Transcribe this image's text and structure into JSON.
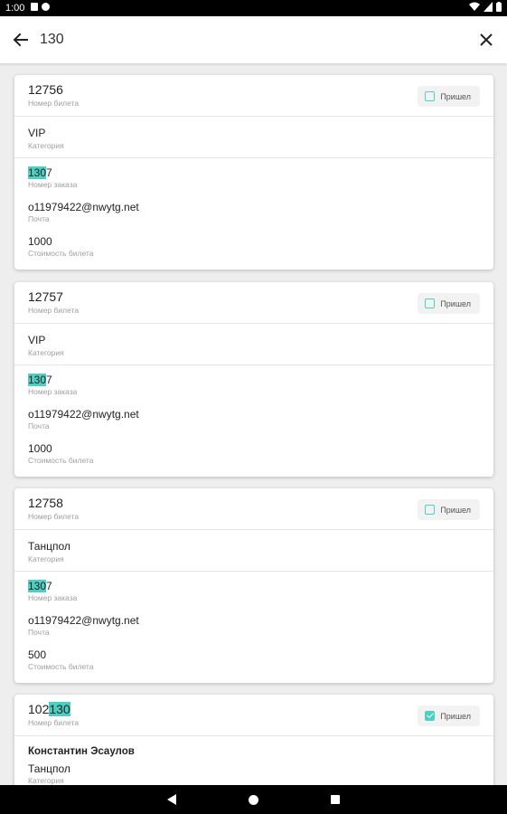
{
  "status": {
    "time": "1:00"
  },
  "search": {
    "query": "130"
  },
  "field_labels": {
    "ticket_number": "Номер билета",
    "category": "Категория",
    "order_number": "Номер заказа",
    "email": "Почта",
    "price": "Стоимость билета"
  },
  "checkin_label": "Пришел",
  "tickets": [
    {
      "ticket": "12756",
      "category": "VIP",
      "order_hl": "130",
      "order_rest": "7",
      "email": "o11979422@nwytg.net",
      "price": "1000",
      "checked": false
    },
    {
      "ticket": "12757",
      "category": "VIP",
      "order_hl": "130",
      "order_rest": "7",
      "email": "o11979422@nwytg.net",
      "price": "1000",
      "checked": false
    },
    {
      "ticket": "12758",
      "category": "Танцпол",
      "order_hl": "130",
      "order_rest": "7",
      "email": "o11979422@nwytg.net",
      "price": "500",
      "checked": false
    },
    {
      "ticket_pre": "102",
      "ticket_hl": "130",
      "name": "Константин Эсаулов",
      "category": "Танцпол",
      "checked": true
    }
  ],
  "colors": {
    "highlight": "#4dd0c4",
    "checkbox": "#4dd0c4"
  }
}
